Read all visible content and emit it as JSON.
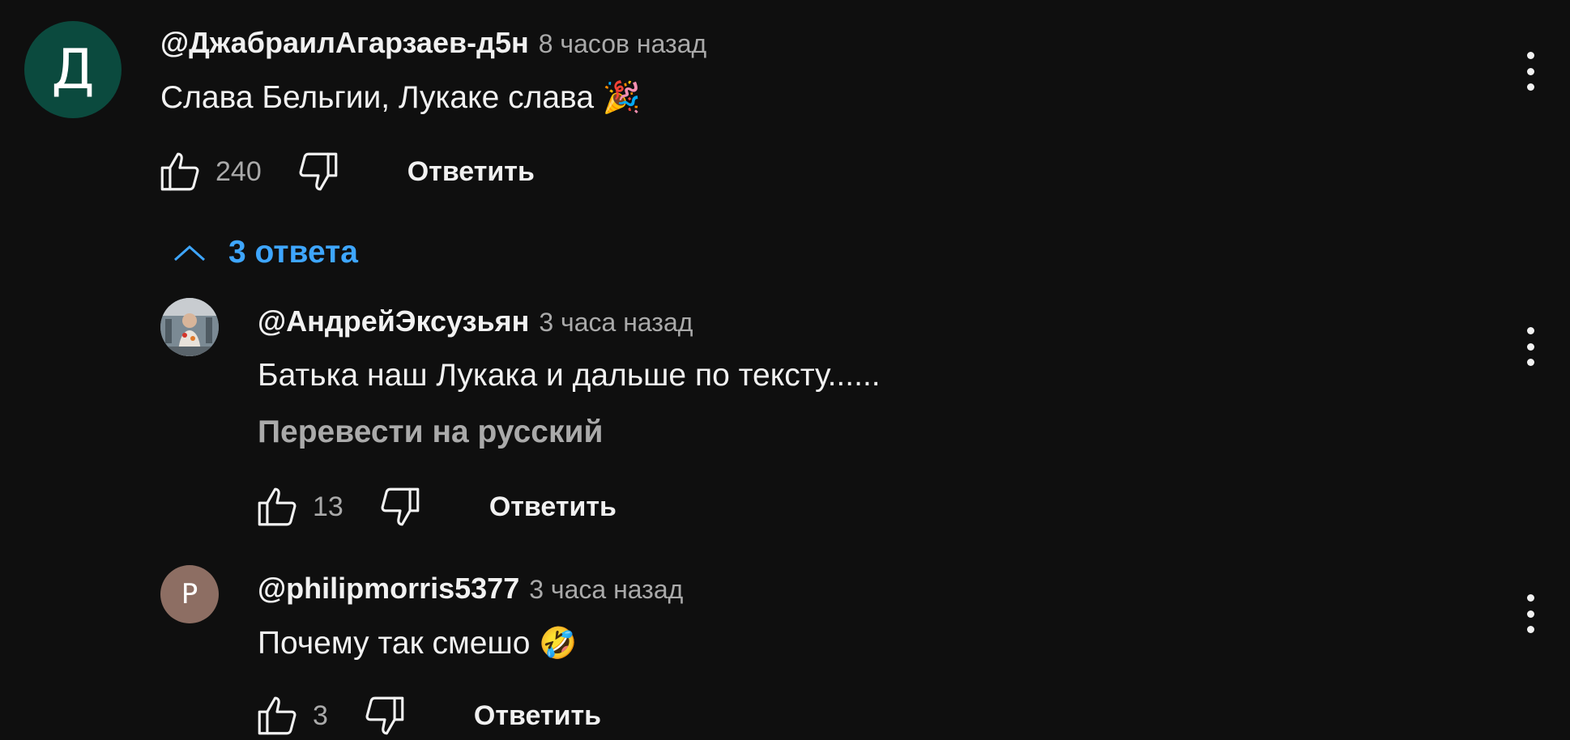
{
  "comment": {
    "avatar_letter": "Д",
    "avatar_color": "#0b4a3e",
    "author": "@ДжабраилАгарзаев-д5н",
    "time": "8 часов назад",
    "text": "Слава Бельгии, Лукаке слава",
    "emoji": "🎉",
    "likes": "240",
    "reply_label": "Ответить",
    "icons": [
      "like-icon",
      "dislike-icon",
      "more-vert-icon"
    ]
  },
  "replies_toggle": {
    "label": "3 ответа",
    "icon": "chevron-up-icon"
  },
  "replies": [
    {
      "avatar_type": "photo",
      "author": "@АндрейЭксузьян",
      "time": "3 часа назад",
      "text": "Батька наш Лукака и дальше по тексту......",
      "translate_label": "Перевести на русский",
      "likes": "13",
      "reply_label": "Ответить"
    },
    {
      "avatar_letter": "P",
      "avatar_color": "#8d6e63",
      "author": "@philipmorris5377",
      "time": "3 часа назад",
      "text": "Почему так смешо",
      "emoji": "🤣",
      "likes": "3",
      "reply_label": "Ответить"
    }
  ]
}
